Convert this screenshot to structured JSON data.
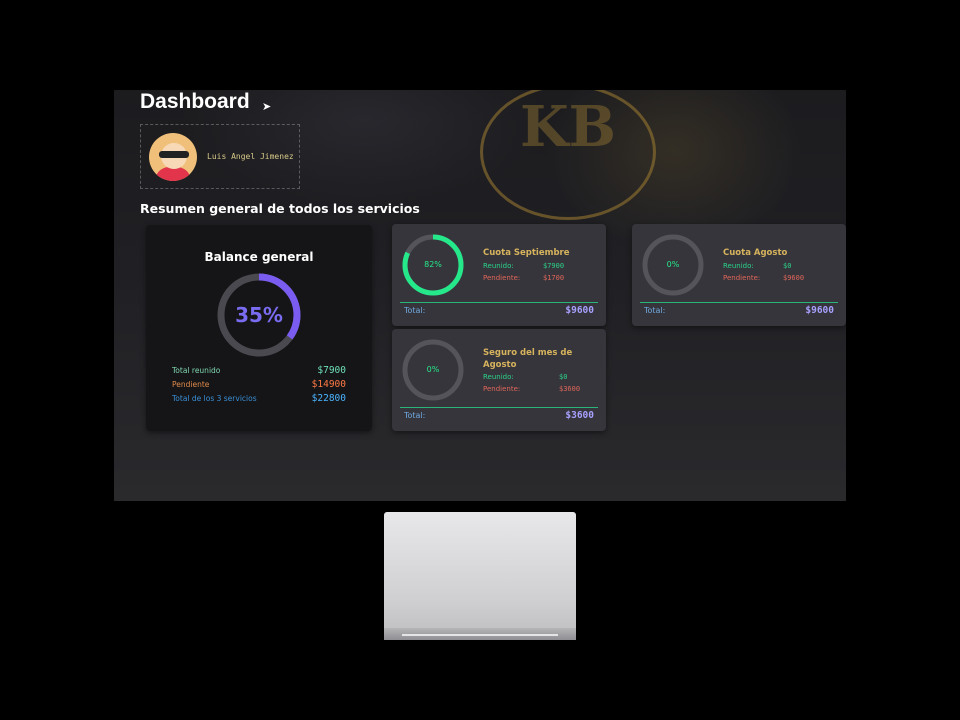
{
  "header": {
    "title": "Dashboard",
    "icon": "rocket-icon"
  },
  "profile": {
    "name": "Luis Angel Jimenez"
  },
  "section_title": "Resumen general de todos los servicios",
  "balance": {
    "title": "Balance general",
    "percent_label": "35%",
    "progress": 0.35,
    "accent": "#7a5cf0",
    "rows": [
      {
        "label": "Total reunido",
        "value": "$7900",
        "label_color": "#7fd6b0",
        "value_color": "#6fe0b8"
      },
      {
        "label": "Pendiente",
        "value": "$14900",
        "label_color": "#e08a4a",
        "value_color": "#ff7a45"
      },
      {
        "label": "Total de los 3 servicios",
        "value": "$22800",
        "label_color": "#3a8fd6",
        "value_color": "#4ab4ff"
      }
    ]
  },
  "services": [
    {
      "name": "Cuota Septiembre",
      "percent_label": "82%",
      "progress": 0.82,
      "reunido_label": "Reunido:",
      "reunido_value": "$7900",
      "pendiente_label": "Pendiente:",
      "pendiente_value": "$1700",
      "total_label": "Total:",
      "total_value": "$9600"
    },
    {
      "name": "Seguro del mes de Agosto",
      "percent_label": "0%",
      "progress": 0,
      "reunido_label": "Reunido:",
      "reunido_value": "$0",
      "pendiente_label": "Pendiente:",
      "pendiente_value": "$3600",
      "total_label": "Total:",
      "total_value": "$3600"
    },
    {
      "name": "Cuota Agosto",
      "percent_label": "0%",
      "progress": 0,
      "reunido_label": "Reunido:",
      "reunido_value": "$0",
      "pendiente_label": "Pendiente:",
      "pendiente_value": "$9600",
      "total_label": "Total:",
      "total_value": "$9600"
    }
  ],
  "colors": {
    "progress_green": "#25e88a",
    "ring_track": "#55545a",
    "reunido": "#2bd38a",
    "pendiente": "#e0665a"
  }
}
